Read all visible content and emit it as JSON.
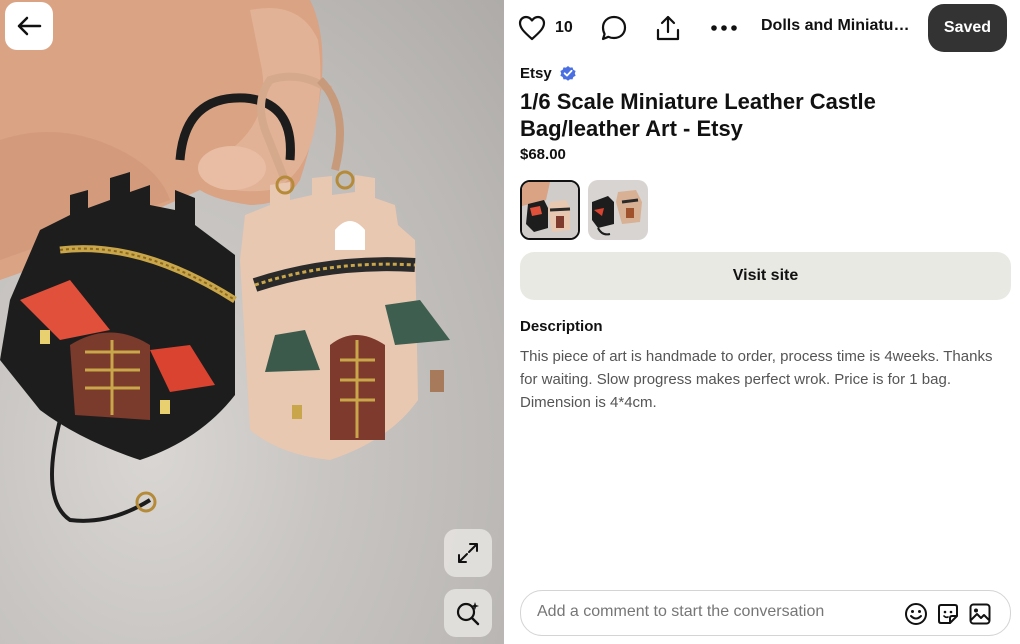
{
  "image": {
    "alt": "",
    "back_icon": "arrow-left-icon",
    "expand_icon": "expand-icon",
    "lens_icon": "visual-search-icon"
  },
  "toolbar": {
    "like_icon": "heart-icon",
    "like_count": "10",
    "comment_icon": "comment-bubble-icon",
    "share_icon": "share-upload-icon",
    "more_icon": "ellipsis-icon",
    "board_name": "Dolls and Miniatur...",
    "saved_label": "Saved"
  },
  "pin": {
    "source": "Etsy",
    "verified_icon": "verified-badge-icon",
    "title": "1/6 Scale Miniature Leather Castle Bag/leather Art - Etsy",
    "price": "$68.00",
    "thumbnails": [
      {
        "selected": true
      },
      {
        "selected": false
      }
    ],
    "visit_label": "Visit site",
    "description_heading": "Description",
    "description": "This piece of art is handmade to order, process time is 4weeks. Thanks for waiting. Slow progress makes perfect wrok. Price is for 1 bag. Dimension is 4*4cm."
  },
  "comment": {
    "placeholder": "Add a comment to start the conversation",
    "emoji_icon": "smiley-icon",
    "sticker_icon": "sticker-icon",
    "photo_icon": "image-upload-icon"
  },
  "colors": {
    "saved_button": "#333333",
    "visit_button": "#e9e9e4",
    "verified": "#4a6fe3"
  }
}
